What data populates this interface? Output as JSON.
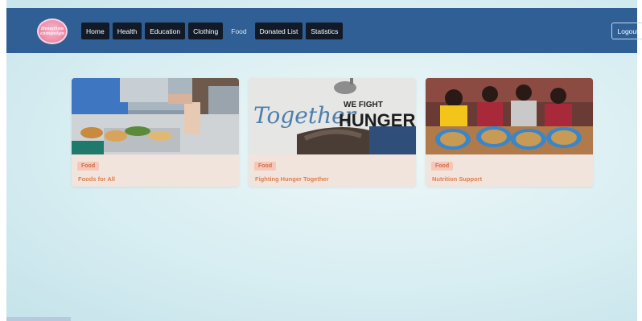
{
  "navbar": {
    "logo_text_line1": "Donation",
    "logo_text_line2": "campaign",
    "items": [
      {
        "label": "Home",
        "active": false
      },
      {
        "label": "Health",
        "active": false
      },
      {
        "label": "Education",
        "active": false
      },
      {
        "label": "Clothing",
        "active": false
      },
      {
        "label": "Food",
        "active": true
      },
      {
        "label": "Donated List",
        "active": false
      },
      {
        "label": "Statistics",
        "active": false
      }
    ],
    "logout_label": "Logout"
  },
  "cards": [
    {
      "category": "Food",
      "title": "Foods for All",
      "image_text_1": "",
      "image_text_2": ""
    },
    {
      "category": "Food",
      "title": "Fighting Hunger Together",
      "image_text_1": "Together",
      "image_text_2": "WE FIGHT",
      "image_text_3": "HUNGER"
    },
    {
      "category": "Food",
      "title": "Nutrition Support",
      "image_text_1": "",
      "image_text_2": ""
    }
  ],
  "colors": {
    "navbar": "#2f5f95",
    "nav_button": "#111a26",
    "card_bg": "#f1e4dd",
    "badge_bg": "#f6c7b8",
    "accent": "#e07e4a"
  }
}
